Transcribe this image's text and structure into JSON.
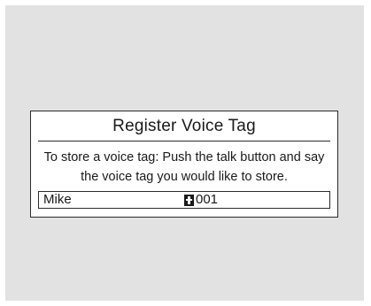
{
  "dialog": {
    "title": "Register Voice Tag",
    "message": "To store a voice tag: Push the talk button and say the voice tag you would like to store."
  },
  "entry": {
    "name": "Mike",
    "number_icon": "phone-book-icon",
    "number": "001"
  }
}
